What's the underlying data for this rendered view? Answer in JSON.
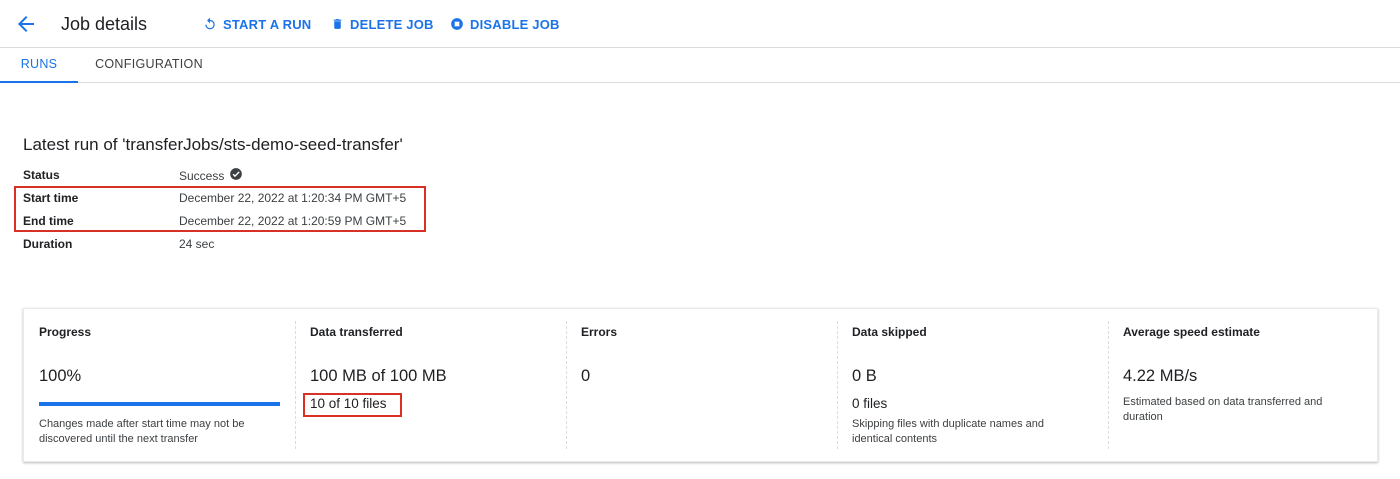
{
  "header": {
    "title": "Job details",
    "actions": [
      {
        "label": "START A RUN",
        "icon": "refresh-icon"
      },
      {
        "label": "DELETE JOB",
        "icon": "trash-icon"
      },
      {
        "label": "DISABLE JOB",
        "icon": "stop-circle-icon"
      }
    ]
  },
  "tabs": [
    {
      "label": "RUNS",
      "active": true
    },
    {
      "label": "CONFIGURATION",
      "active": false
    }
  ],
  "latest_run": {
    "title": "Latest run of 'transferJobs/sts-demo-seed-transfer'",
    "rows": [
      {
        "label": "Status",
        "value": "Success",
        "icon": "check-circle-icon"
      },
      {
        "label": "Start time",
        "value": "December 22, 2022 at 1:20:34 PM GMT+5"
      },
      {
        "label": "End time",
        "value": "December 22, 2022 at 1:20:59 PM GMT+5"
      },
      {
        "label": "Duration",
        "value": "24 sec"
      }
    ]
  },
  "stats": {
    "progress": {
      "label": "Progress",
      "value": "100%",
      "fraction": 1.0,
      "note": "Changes made after start time may not be discovered until the next transfer"
    },
    "data_transferred": {
      "label": "Data transferred",
      "value": "100 MB of 100 MB",
      "sub": "10 of 10 files"
    },
    "errors": {
      "label": "Errors",
      "value": "0"
    },
    "data_skipped": {
      "label": "Data skipped",
      "value": "0 B",
      "sub": "0 files",
      "note": "Skipping files with duplicate names and identical contents"
    },
    "speed": {
      "label": "Average speed estimate",
      "value": "4.22 MB/s",
      "note": "Estimated based on data transferred and duration"
    }
  },
  "colors": {
    "accent": "#1a73e8",
    "highlight": "#d93025"
  }
}
